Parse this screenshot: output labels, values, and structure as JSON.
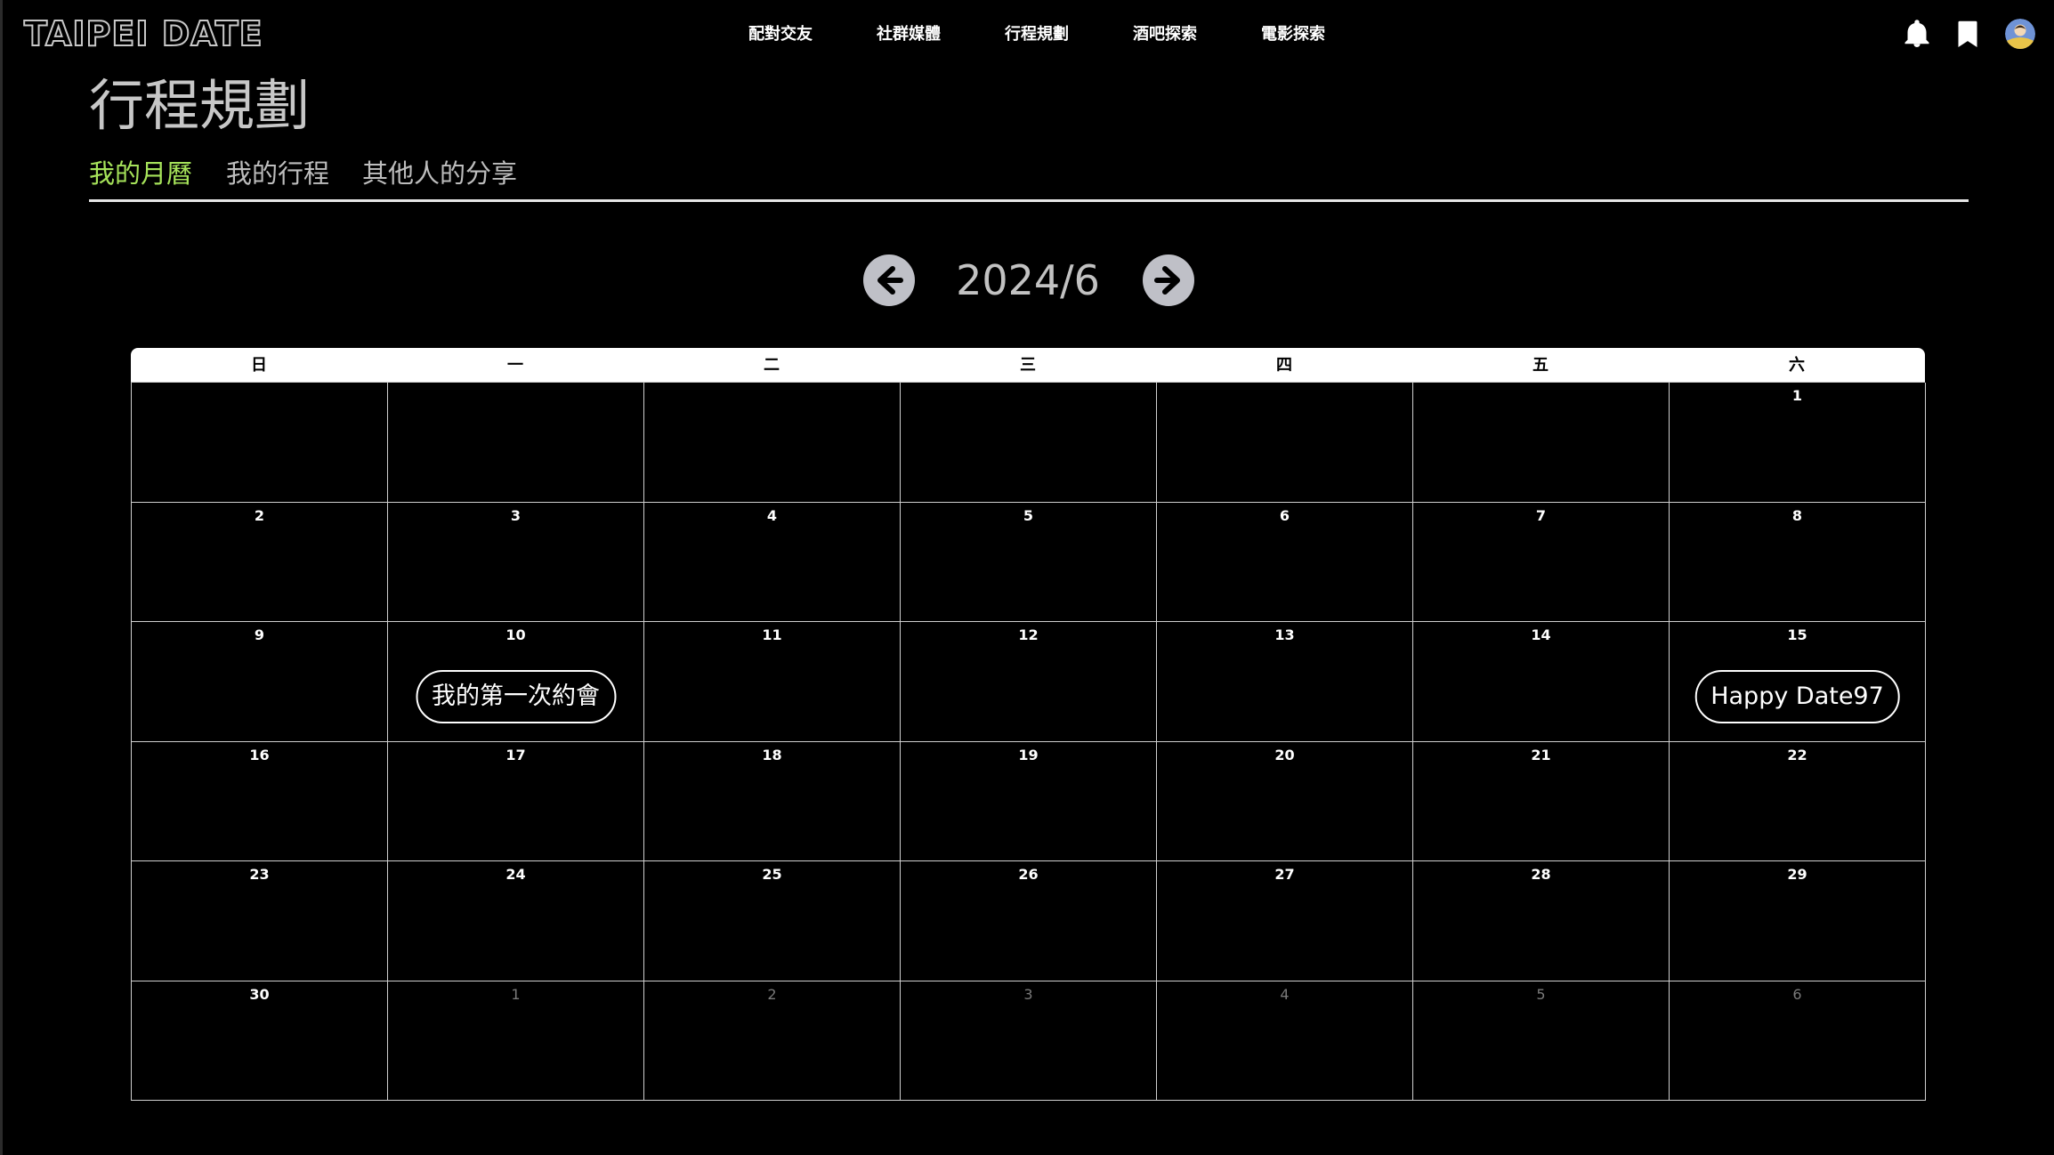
{
  "brand": "TAIPEI DATE",
  "nav": {
    "items": [
      "配對交友",
      "社群媒體",
      "行程規劃",
      "酒吧探索",
      "電影探索"
    ]
  },
  "page": {
    "title": "行程規劃",
    "tabs": [
      {
        "label": "我的月曆",
        "active": true
      },
      {
        "label": "我的行程",
        "active": false
      },
      {
        "label": "其他人的分享",
        "active": false
      }
    ]
  },
  "calendar": {
    "month_label": "2024/6",
    "weekdays": [
      "日",
      "一",
      "二",
      "三",
      "四",
      "五",
      "六"
    ],
    "weeks": [
      [
        {
          "d": ""
        },
        {
          "d": ""
        },
        {
          "d": ""
        },
        {
          "d": ""
        },
        {
          "d": ""
        },
        {
          "d": ""
        },
        {
          "d": "1"
        }
      ],
      [
        {
          "d": "2"
        },
        {
          "d": "3"
        },
        {
          "d": "4"
        },
        {
          "d": "5"
        },
        {
          "d": "6"
        },
        {
          "d": "7"
        },
        {
          "d": "8"
        }
      ],
      [
        {
          "d": "9"
        },
        {
          "d": "10",
          "event": "我的第一次約會"
        },
        {
          "d": "11"
        },
        {
          "d": "12"
        },
        {
          "d": "13"
        },
        {
          "d": "14"
        },
        {
          "d": "15",
          "event": "Happy Date97"
        }
      ],
      [
        {
          "d": "16"
        },
        {
          "d": "17"
        },
        {
          "d": "18"
        },
        {
          "d": "19"
        },
        {
          "d": "20"
        },
        {
          "d": "21"
        },
        {
          "d": "22"
        }
      ],
      [
        {
          "d": "23"
        },
        {
          "d": "24"
        },
        {
          "d": "25"
        },
        {
          "d": "26"
        },
        {
          "d": "27"
        },
        {
          "d": "28"
        },
        {
          "d": "29"
        }
      ],
      [
        {
          "d": "30"
        },
        {
          "d": "1",
          "other": true
        },
        {
          "d": "2",
          "other": true
        },
        {
          "d": "3",
          "other": true
        },
        {
          "d": "4",
          "other": true
        },
        {
          "d": "5",
          "other": true
        },
        {
          "d": "6",
          "other": true
        }
      ]
    ]
  },
  "icons": {
    "notifications": "bell-icon",
    "bookmarks": "bookmark-icon",
    "prev_month": "arrow-left-icon",
    "next_month": "arrow-right-icon"
  },
  "colors": {
    "background": "#000000",
    "active_tab": "#a6e35a",
    "arrow_button": "#bfc0c7"
  }
}
